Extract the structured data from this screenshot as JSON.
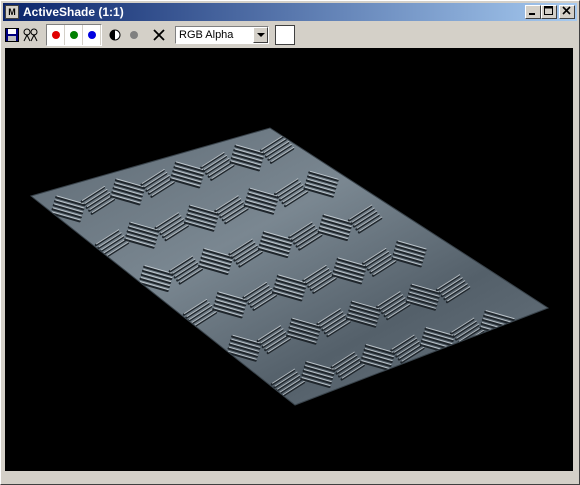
{
  "window": {
    "title": "ActiveShade (1:1)",
    "app_icon": "3ds-max-icon",
    "controls": [
      "minimize-icon",
      "maximize-icon",
      "close-icon"
    ]
  },
  "toolbar": {
    "tools": [
      "save-icon",
      "clone-icon"
    ],
    "channels": [
      {
        "name": "red-channel",
        "color": "#e00000"
      },
      {
        "name": "green-channel",
        "color": "#008000"
      },
      {
        "name": "blue-channel",
        "color": "#0000e0"
      }
    ],
    "mono_icon": "half-circle-icon",
    "alpha_icon": "dot-icon",
    "clear_icon": "x-icon",
    "display_mode": "RGB Alpha",
    "swatch_color": "#ffffff"
  },
  "viewport": {
    "background": "#000000",
    "content": "diamond-plate-render"
  }
}
